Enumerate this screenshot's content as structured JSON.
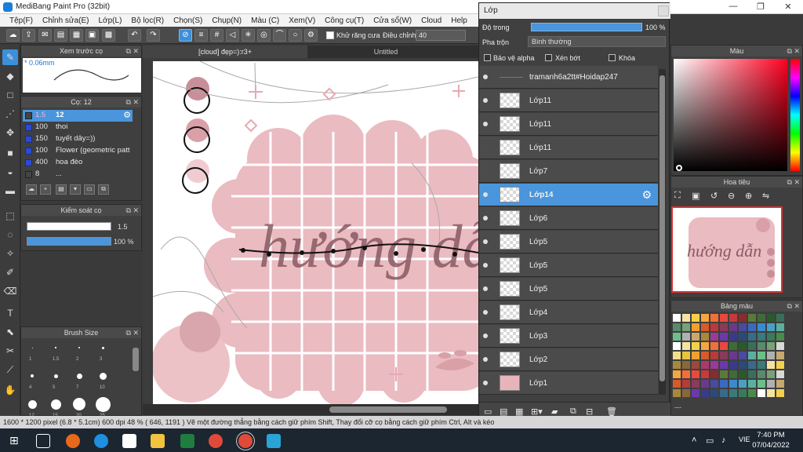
{
  "window": {
    "title": "MediBang Paint Pro (32bit)",
    "minimize": "—",
    "maximize": "❐",
    "close": "✕"
  },
  "menu": [
    "Tệp(F)",
    "Chỉnh sửa(E)",
    "Lớp(L)",
    "Bộ lọc(R)",
    "Chọn(S)",
    "Chụp(N)",
    "Màu (C)",
    "Xem(V)",
    "Công cụ(T)",
    "Cửa sổ(W)",
    "Cloud",
    "Help"
  ],
  "toolbar": {
    "antialias_label": "Khử răng cưa",
    "adjust_label": "Điều chỉnh",
    "adjust_value": "40"
  },
  "brush_preview": {
    "title": "Xem trước cọ",
    "size": "* 0.06mm"
  },
  "brush_list": {
    "title": "Cọ: 12",
    "items": [
      {
        "value": "1.5",
        "name": "12",
        "selected": true
      },
      {
        "value": "100",
        "name": "thoi"
      },
      {
        "value": "150",
        "name": "tuyết dây=))"
      },
      {
        "value": "100",
        "name": "Flower (geometric patt"
      },
      {
        "value": "400",
        "name": "hoa đèo"
      },
      {
        "value": "8",
        "name": "..."
      }
    ]
  },
  "brush_control": {
    "title": "Kiểm soát cọ",
    "size_value": "1.5",
    "opacity_value": "100 %",
    "opacity_fraction": 1.0
  },
  "brush_size": {
    "title": "Brush Size",
    "labels": [
      "1",
      "1.5",
      "2",
      "3",
      "4",
      "5",
      "7",
      "10",
      "12",
      "15",
      "20",
      "25"
    ]
  },
  "document_tabs": [
    {
      "label": "[cloud] đẹp=):r3+",
      "active": true
    },
    {
      "label": "Untitled",
      "active": false
    }
  ],
  "artwork": {
    "title_text": "hướng dẫn"
  },
  "layers": {
    "title": "Lớp",
    "opacity_label": "Độ trong",
    "opacity_value": "100 %",
    "blend_label": "Pha trộn",
    "blend_value": "Bình thường",
    "protect_alpha": "Bảo vệ alpha",
    "clipping": "Xén bớt",
    "lock": "Khóa",
    "items": [
      {
        "name": "tramanh6a2tt#Hoidap247",
        "visible": true,
        "text_layer": true
      },
      {
        "name": "Lớp11",
        "visible": true
      },
      {
        "name": "Lớp11",
        "visible": true
      },
      {
        "name": "Lớp11",
        "visible": false
      },
      {
        "name": "Lớp7",
        "visible": false
      },
      {
        "name": "Lớp14",
        "visible": true,
        "selected": true
      },
      {
        "name": "Lớp6",
        "visible": true
      },
      {
        "name": "Lớp5",
        "visible": true
      },
      {
        "name": "Lớp5",
        "visible": true
      },
      {
        "name": "Lớp5",
        "visible": true
      },
      {
        "name": "Lớp4",
        "visible": true
      },
      {
        "name": "Lớp3",
        "visible": true
      },
      {
        "name": "Lớp2",
        "visible": true
      },
      {
        "name": "Lớp1",
        "visible": true,
        "pink": true
      }
    ]
  },
  "color_panel": {
    "title": "Màu"
  },
  "navigator": {
    "title": "Hoa tiêu"
  },
  "palette": {
    "title": "Bảng màu"
  },
  "status": {
    "text": "1600 * 1200 pixel  (6.8 * 5.1cm)  600 dpi  48 %  ( 646, 1191 )  Vẽ một đường thẳng bằng cách giữ phím Shift, Thay đổi cỡ cọ bằng cách giữ phím Ctrl, Alt và kéo"
  },
  "taskbar": {
    "lang": "VIE",
    "time": "7:40 PM",
    "date": "07/04/2022"
  },
  "colors": {
    "accent": "#4a95db",
    "pink": "#e8b4bb",
    "pink_dark": "#c98f98",
    "lettering": "#8a5a62"
  }
}
